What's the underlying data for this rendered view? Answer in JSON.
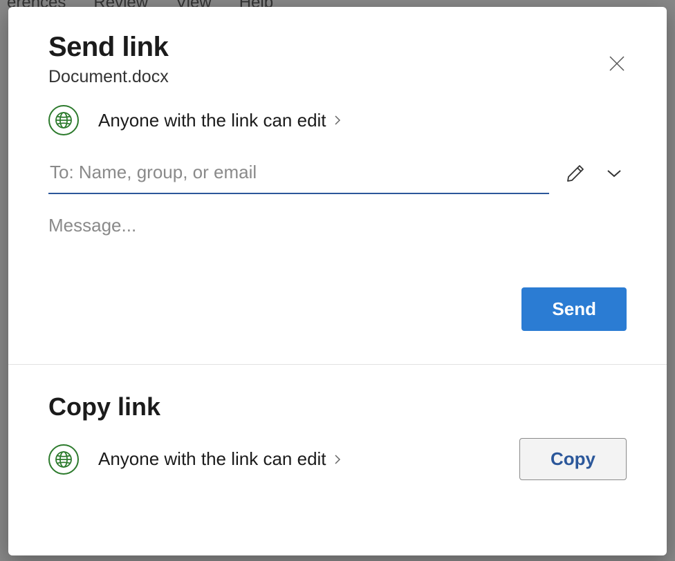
{
  "backdrop": {
    "menu_items": [
      "erences",
      "Review",
      "View",
      "Help"
    ]
  },
  "dialog": {
    "title": "Send link",
    "subtitle": "Document.docx",
    "permission_text": "Anyone with the link can edit",
    "to_placeholder": "To: Name, group, or email",
    "to_value": "",
    "message_placeholder": "Message...",
    "message_value": "",
    "send_button": "Send"
  },
  "copy_section": {
    "title": "Copy link",
    "permission_text": "Anyone with the link can edit",
    "copy_button": "Copy"
  }
}
